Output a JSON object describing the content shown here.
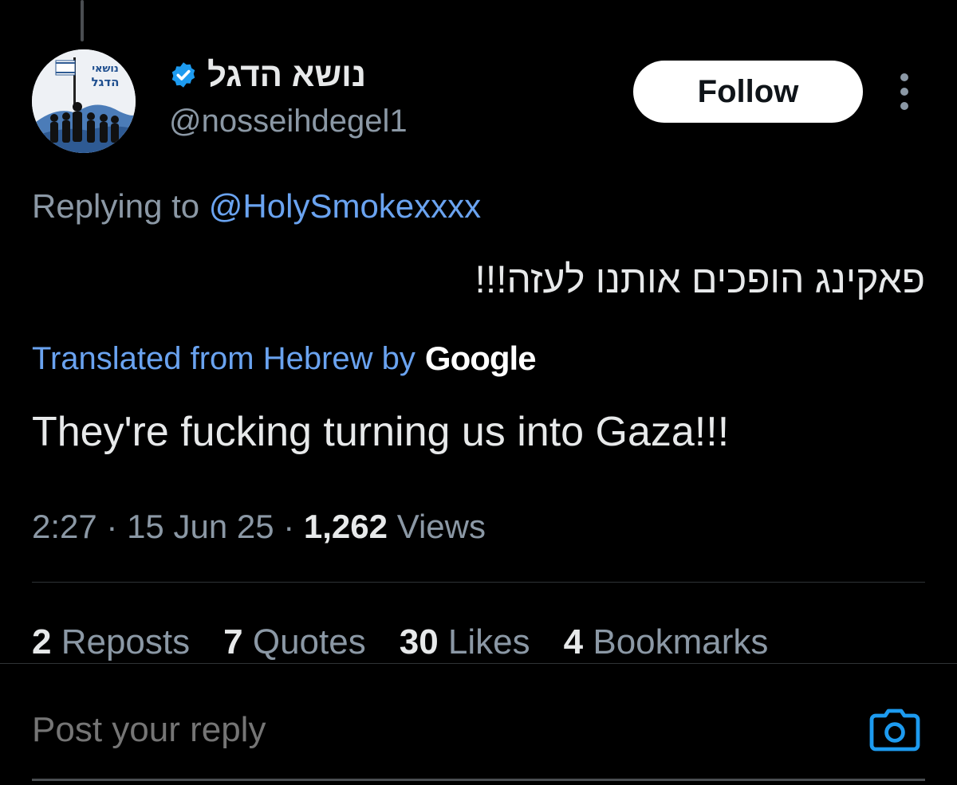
{
  "author": {
    "display_name": "נושא הדגל",
    "handle": "@nosseihdegel1",
    "verified": true,
    "avatar_text": "נושאי הדגל"
  },
  "follow_label": "Follow",
  "replying": {
    "prefix": "Replying to",
    "mention": "@HolySmokexxxx"
  },
  "tweet": {
    "original_text": "פאקינג הופכים אותנו לעזה!!!",
    "translated_label": "Translated from Hebrew by",
    "translator_logo": "Google",
    "translated_text": "They're fucking turning us into Gaza!!!"
  },
  "meta": {
    "time": "2:27",
    "date": "15 Jun 25",
    "views_count": "1,262",
    "views_label": "Views"
  },
  "stats": [
    {
      "count": "2",
      "label": "Reposts"
    },
    {
      "count": "7",
      "label": "Quotes"
    },
    {
      "count": "30",
      "label": "Likes"
    },
    {
      "count": "4",
      "label": "Bookmarks"
    }
  ],
  "reply": {
    "placeholder": "Post your reply"
  },
  "colors": {
    "background": "#000000",
    "accent_blue": "#1d9bf0",
    "link_blue": "#6aa3f0",
    "secondary_text": "#8b98a5",
    "primary_text": "#e7e9ea"
  },
  "icons": {
    "verified": "verified-badge-icon",
    "more": "more-vertical-icon",
    "camera": "camera-icon"
  }
}
